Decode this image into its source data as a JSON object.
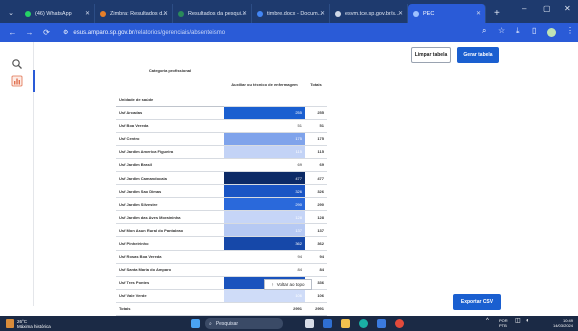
{
  "browser": {
    "tabs": [
      {
        "label": "(46) WhatsApp",
        "color": "#25d366"
      },
      {
        "label": "Zimbra: Resultados d...",
        "color": "#e57f2a"
      },
      {
        "label": "Resultados da pesqui...",
        "color": "#2a8a5a"
      },
      {
        "label": "timbre.docx - Docum...",
        "color": "#4285f4"
      },
      {
        "label": "esvm.tce.sp.gov.br/s...",
        "color": "#cfd8e8"
      },
      {
        "label": "PEC",
        "color": "#9ec1ff"
      }
    ],
    "url_domain": "esus.amparo.sp.gov.br",
    "url_path": "/relatorios/gerenciais/absenteismo"
  },
  "actions": {
    "clear_label": "Limpar tabela",
    "generate_label": "Gerar tabela",
    "csv_label": "Exportar CSV",
    "back_top_label": "Voltar ao topo"
  },
  "table": {
    "col_group_header": "Categoria profissional",
    "col_header": "Auxiliar ou técnico de enfermagem",
    "total_header": "Totais",
    "row_header": "Unidade de saúde",
    "rows": [
      {
        "name": "Usf Arcadas",
        "value": "255",
        "total": "255",
        "color": "#1a5fd0",
        "text": "#ffffff"
      },
      {
        "name": "Usf Boa Vereda",
        "value": "51",
        "total": "51",
        "color": "#ffffff",
        "text": "#333333"
      },
      {
        "name": "Usf Centro",
        "value": "175",
        "total": "175",
        "color": "#7fa3eb",
        "text": "#ffffff"
      },
      {
        "name": "Usf Jardim America Figueira",
        "value": "115",
        "total": "115",
        "color": "#c3d3f6",
        "text": "#ffffff"
      },
      {
        "name": "Usf Jardim Brasil",
        "value": "69",
        "total": "69",
        "color": "#ffffff",
        "text": "#333333"
      },
      {
        "name": "Usf Jardim Camandocaia",
        "value": "477",
        "total": "477",
        "color": "#0c2a66",
        "text": "#ffffff"
      },
      {
        "name": "Usf Jardim Sao Dimas",
        "value": "326",
        "total": "326",
        "color": "#1a55c4",
        "text": "#ffffff"
      },
      {
        "name": "Usf Jardim Silvestre",
        "value": "290",
        "total": "290",
        "color": "#2a69db",
        "text": "#ffffff"
      },
      {
        "name": "Usf Jardim das Aves Moraininha",
        "value": "128",
        "total": "128",
        "color": "#c6d5f7",
        "text": "#ffffff"
      },
      {
        "name": "Usf Mon Asun Rural do Pantaleao",
        "value": "137",
        "total": "137",
        "color": "#b6c9f3",
        "text": "#ffffff"
      },
      {
        "name": "Usf Pinheirinho",
        "value": "362",
        "total": "362",
        "color": "#1648a9",
        "text": "#ffffff"
      },
      {
        "name": "Usf Rosas Boa Vereda",
        "value": "94",
        "total": "94",
        "color": "#ffffff",
        "text": "#333333"
      },
      {
        "name": "Usf Santa Maria do Amparo",
        "value": "84",
        "total": "84",
        "color": "#ffffff",
        "text": "#333333"
      },
      {
        "name": "Usf Tres Pontes",
        "value": "336",
        "total": "336",
        "color": "#1a53bd",
        "text": "#ffffff"
      },
      {
        "name": "Usf Vale Verde",
        "value": "106",
        "total": "106",
        "color": "#cfdcf8",
        "text": "#ffffff"
      }
    ],
    "totals_row": {
      "name": "Totais",
      "value": "2991",
      "total": "2991"
    }
  },
  "taskbar": {
    "temp": "26°C",
    "weather": "Máxima histórica",
    "search_placeholder": "Pesquisar",
    "lang": "POR",
    "lang2": "PTB",
    "time": "10:49",
    "date": "14/03/2024"
  }
}
